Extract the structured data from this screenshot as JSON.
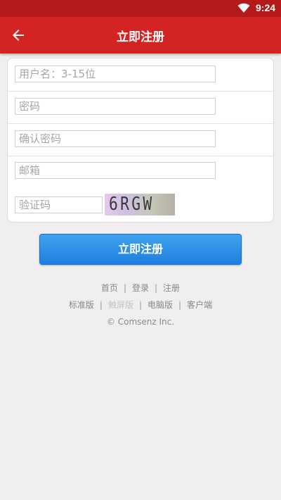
{
  "status_bar": {
    "time": "9:24",
    "wifi_icon": "wifi-icon"
  },
  "app_bar": {
    "title": "立即注册",
    "back_icon": "arrow-left-icon"
  },
  "form": {
    "username_placeholder": "用户名：3-15位",
    "password_placeholder": "密码",
    "confirm_password_placeholder": "确认密码",
    "email_placeholder": "邮箱",
    "captcha_placeholder": "验证码",
    "captcha_text": "6RGW"
  },
  "submit_label": "立即注册",
  "footer": {
    "nav": [
      "首页",
      "登录",
      "注册"
    ],
    "versions": [
      "标准版",
      "触屏版",
      "电脑版",
      "客户端"
    ],
    "separator": "|",
    "copyright": "© Comsenz Inc."
  },
  "colors": {
    "app_bar": "#d32323",
    "status_bar": "#b51a1a",
    "button_top": "#40a3ee",
    "button_bottom": "#1e7fde"
  }
}
